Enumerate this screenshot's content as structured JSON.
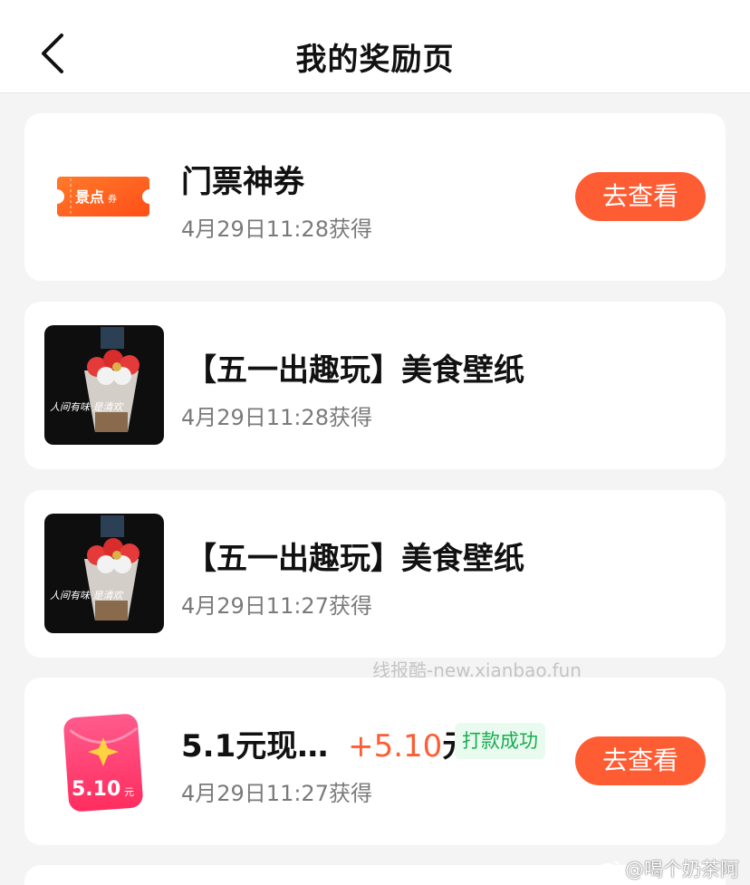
{
  "header": {
    "title": "我的奖励页",
    "back_icon": "chevron-left-icon"
  },
  "rewards": [
    {
      "icon": "scenic-ticket-icon",
      "icon_text_main": "景点",
      "icon_text_sub": "券",
      "name": "门票神券",
      "time": "4月29日11:28获得",
      "button": "去查看"
    },
    {
      "icon": "food-wallpaper-thumbnail",
      "icon_text": "人间有味 是清欢",
      "name": "【五一出趣玩】美食壁纸",
      "time": "4月29日11:28获得"
    },
    {
      "icon": "food-wallpaper-thumbnail",
      "icon_text": "人间有味 是清欢",
      "name": "【五一出趣玩】美食壁纸",
      "time": "4月29日11:27获得"
    },
    {
      "icon": "red-packet-icon",
      "icon_amount": "5.10",
      "icon_unit": "元",
      "name": "5.1元现…",
      "amount": "+5.10",
      "amount_unit": "元",
      "badge": "打款成功",
      "time": "4月29日11:27获得",
      "button": "去查看"
    }
  ],
  "watermark": "线报酷-new.xianbao.fun",
  "weibo_watermark": "@喝个奶茶阿",
  "colors": {
    "accent": "#fe5d34",
    "success": "#1aac52",
    "background": "#f4f4f4"
  }
}
